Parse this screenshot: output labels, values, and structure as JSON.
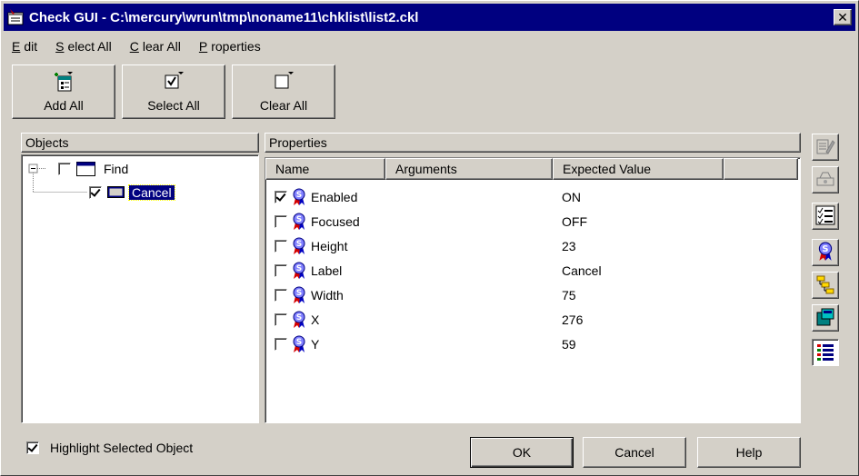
{
  "window": {
    "title": "Check GUI - C:\\mercury\\wrun\\tmp\\noname11\\chklist\\list2.ckl",
    "close_symbol": "✕"
  },
  "menu": [
    {
      "label": "Edit",
      "underline": "E",
      "rest": "dit"
    },
    {
      "label": "Select All",
      "underline": "S",
      "rest": "elect All"
    },
    {
      "label": "Clear All",
      "underline": "C",
      "rest": "lear All"
    },
    {
      "label": "Properties",
      "underline": "P",
      "rest": "roperties"
    }
  ],
  "toolbar": {
    "add_all": "Add All",
    "select_all": "Select All",
    "clear_all": "Clear All"
  },
  "objects_pane": {
    "header": "Objects",
    "tree": [
      {
        "label": "Find",
        "checked": false,
        "expanded": true,
        "icon": "window-icon"
      },
      {
        "label": "Cancel",
        "checked": true,
        "selected": true,
        "icon": "button-object-icon"
      }
    ]
  },
  "properties_pane": {
    "header": "Properties",
    "columns": [
      "Name",
      "Arguments",
      "Expected Value"
    ],
    "rows": [
      {
        "name": "Enabled",
        "arguments": "",
        "expected": "ON",
        "checked": true
      },
      {
        "name": "Focused",
        "arguments": "",
        "expected": "OFF",
        "checked": false
      },
      {
        "name": "Height",
        "arguments": "",
        "expected": "23",
        "checked": false
      },
      {
        "name": "Label",
        "arguments": "",
        "expected": "Cancel",
        "checked": false
      },
      {
        "name": "Width",
        "arguments": "",
        "expected": "75",
        "checked": false
      },
      {
        "name": "X",
        "arguments": "",
        "expected": "276",
        "checked": false
      },
      {
        "name": "Y",
        "arguments": "",
        "expected": "59",
        "checked": false
      }
    ]
  },
  "side_toolbar": [
    "edit-expected-icon",
    "edit-arguments-icon",
    "check-list-icon",
    "property-icon",
    "hierarchy-icon",
    "object-class-icon",
    "list-view-icon"
  ],
  "footer": {
    "highlight_label": "Highlight Selected Object",
    "highlight_checked": true,
    "ok": "OK",
    "cancel": "Cancel",
    "help": "Help"
  },
  "colors": {
    "title_bg": "#000080",
    "face": "#d4d0c8",
    "selection_bg": "#000080"
  }
}
